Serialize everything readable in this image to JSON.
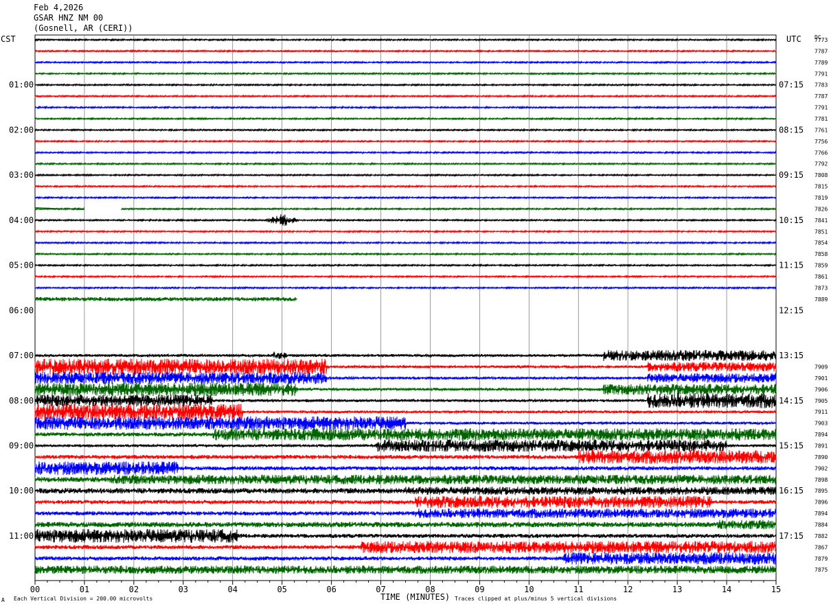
{
  "header": {
    "date": "Feb 4,2026",
    "station": "GSAR HNZ NM 00",
    "location": "(Gosnell, AR (CERI))"
  },
  "left_tz": "CST",
  "right_tz": "UTC",
  "dc_header": "DC",
  "footer": {
    "scale_note": "Each Vertical Division =  200.00 microvolts",
    "xlabel": "TIME (MINUTES)",
    "clip_note": "Traces clipped at plus/minus 5 vertical divisions",
    "corner_mark": "A"
  },
  "colors": {
    "black": "#000000",
    "red": "#ff0000",
    "blue": "#0000ff",
    "green": "#006400",
    "grid": "#808080"
  },
  "chart_data": {
    "type": "line",
    "title": "GSAR HNZ NM 00",
    "xlabel": "TIME (MINUTES)",
    "xlim": [
      0,
      15
    ],
    "x_ticks": [
      "00",
      "01",
      "02",
      "03",
      "04",
      "05",
      "06",
      "07",
      "08",
      "09",
      "10",
      "11",
      "12",
      "13",
      "14",
      "15"
    ],
    "left_hour_labels": [
      "01:00",
      "02:00",
      "03:00",
      "04:00",
      "05:00",
      "06:00",
      "07:00",
      "08:00",
      "09:00",
      "10:00",
      "11:00"
    ],
    "right_hour_labels": [
      "07:15",
      "08:15",
      "09:15",
      "10:15",
      "11:15",
      "12:15",
      "13:15",
      "14:15",
      "15:15",
      "16:15",
      "17:15"
    ],
    "color_cycle": [
      "black",
      "red",
      "blue",
      "green"
    ],
    "rows": [
      {
        "dc": "7773",
        "amp": 1
      },
      {
        "dc": "7787",
        "amp": 1
      },
      {
        "dc": "7789",
        "amp": 1
      },
      {
        "dc": "7791",
        "amp": 1
      },
      {
        "dc": "7783",
        "amp": 1
      },
      {
        "dc": "7787",
        "amp": 1
      },
      {
        "dc": "7791",
        "amp": 1
      },
      {
        "dc": "7781",
        "amp": 1
      },
      {
        "dc": "7761",
        "amp": 1
      },
      {
        "dc": "7756",
        "amp": 1
      },
      {
        "dc": "7766",
        "amp": 1
      },
      {
        "dc": "7792",
        "amp": 1
      },
      {
        "dc": "7808",
        "amp": 1
      },
      {
        "dc": "7815",
        "amp": 1
      },
      {
        "dc": "7819",
        "amp": 1
      },
      {
        "dc": "7826",
        "amp": 1,
        "gap": [
          1.0,
          1.75
        ]
      },
      {
        "dc": "7841",
        "amp": 1,
        "event": {
          "start": 4.6,
          "end": 5.4,
          "amp": 10
        }
      },
      {
        "dc": "7851",
        "amp": 1
      },
      {
        "dc": "7854",
        "amp": 1
      },
      {
        "dc": "7858",
        "amp": 1
      },
      {
        "dc": "7859",
        "amp": 1
      },
      {
        "dc": "7861",
        "amp": 1
      },
      {
        "dc": "7873",
        "amp": 1
      },
      {
        "dc": "7889",
        "amp": 3,
        "end": 5.3
      },
      {
        "dc": "",
        "amp": 0
      },
      {
        "dc": "",
        "amp": 0
      },
      {
        "dc": "",
        "amp": 0
      },
      {
        "dc": "",
        "amp": 0
      },
      {
        "dc": "",
        "amp": 2,
        "segs": [
          [
            4.8,
            5.1,
            6
          ],
          [
            11.5,
            15,
            8
          ]
        ]
      },
      {
        "dc": "7909",
        "amp": 2,
        "segs": [
          [
            0,
            5.9,
            12
          ],
          [
            12.4,
            15,
            7
          ]
        ]
      },
      {
        "dc": "7901",
        "amp": 2,
        "segs": [
          [
            0,
            5.9,
            9
          ],
          [
            12.4,
            15,
            7
          ]
        ]
      },
      {
        "dc": "7906",
        "amp": 2,
        "segs": [
          [
            0,
            5.3,
            10
          ],
          [
            11.5,
            15,
            8
          ]
        ]
      },
      {
        "dc": "7905",
        "amp": 2,
        "segs": [
          [
            0,
            3.6,
            9
          ],
          [
            12.4,
            15,
            11
          ]
        ]
      },
      {
        "dc": "7911",
        "amp": 2,
        "segs": [
          [
            0,
            4.2,
            12
          ]
        ]
      },
      {
        "dc": "7903",
        "amp": 2,
        "segs": [
          [
            0,
            7.5,
            10
          ]
        ]
      },
      {
        "dc": "7894",
        "amp": 3,
        "segs": [
          [
            3.6,
            15,
            9
          ]
        ]
      },
      {
        "dc": "7891",
        "amp": 2,
        "segs": [
          [
            6.9,
            14,
            9
          ]
        ]
      },
      {
        "dc": "7890",
        "amp": 3,
        "segs": [
          [
            11,
            15,
            10
          ]
        ]
      },
      {
        "dc": "7902",
        "amp": 3,
        "segs": [
          [
            0,
            2.9,
            10
          ]
        ]
      },
      {
        "dc": "7898",
        "amp": 4,
        "segs": [
          [
            1.5,
            15,
            7
          ]
        ]
      },
      {
        "dc": "7895",
        "amp": 4,
        "segs": [
          [
            7.5,
            15,
            6
          ]
        ]
      },
      {
        "dc": "7896",
        "amp": 3,
        "segs": [
          [
            7.7,
            13.7,
            9
          ]
        ]
      },
      {
        "dc": "7894",
        "amp": 3,
        "segs": [
          [
            7.7,
            15,
            7
          ]
        ]
      },
      {
        "dc": "7884",
        "amp": 4,
        "segs": [
          [
            13.8,
            15,
            7
          ]
        ]
      },
      {
        "dc": "7882",
        "amp": 3,
        "segs": [
          [
            0,
            4.1,
            10
          ]
        ]
      },
      {
        "dc": "7867",
        "amp": 3,
        "segs": [
          [
            6.6,
            15,
            9
          ]
        ]
      },
      {
        "dc": "7879",
        "amp": 3,
        "segs": [
          [
            10.7,
            15,
            9
          ]
        ]
      },
      {
        "dc": "7875",
        "amp": 4,
        "segs": [
          [
            0,
            15,
            6
          ]
        ]
      }
    ]
  }
}
